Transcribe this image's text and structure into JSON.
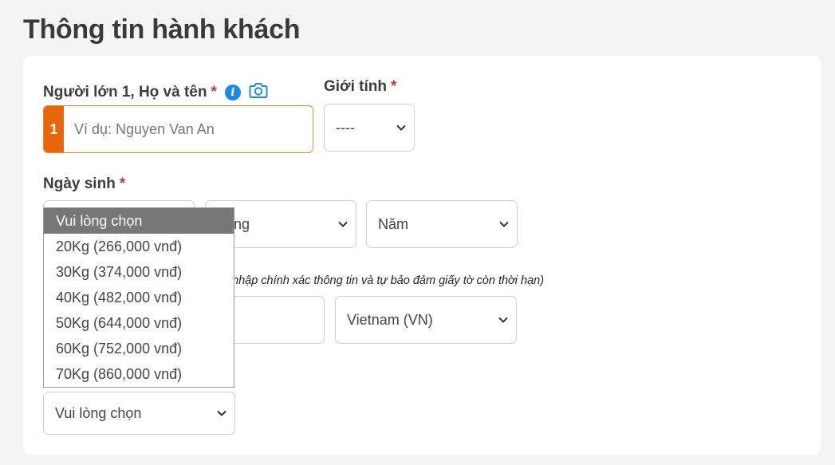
{
  "page": {
    "title": "Thông tin hành khách"
  },
  "passenger": {
    "index": "1",
    "name_label": "Người lớn 1, Họ và tên",
    "name_placeholder": "Ví dụ: Nguyen Van An",
    "required_mark": "*",
    "gender_label": "Giới tính",
    "gender_value": "----",
    "dob_label": "Ngày sinh",
    "dob_month_value": "áng",
    "dob_year_value": "Năm",
    "document_note": "nhập chính xác thông tin và tự bảo đảm giấy tờ còn thời hạn)",
    "nationality_value": "Vietnam (VN)",
    "baggage_value": "Vui lòng chọn"
  },
  "baggage_dropdown": {
    "selected_index": 0,
    "options": [
      "Vui lòng chọn",
      "20Kg (266,000 vnđ)",
      "30Kg (374,000 vnđ)",
      "40Kg (482,000 vnđ)",
      "50Kg (644,000 vnđ)",
      "60Kg (752,000 vnđ)",
      "70Kg (860,000 vnđ)"
    ]
  },
  "colors": {
    "accent": "#e8650e",
    "info": "#1e88e5",
    "required": "#c0392b",
    "selected_bg": "#777777"
  },
  "icons": {
    "info": "info-icon",
    "camera": "camera-icon",
    "chevron": "chevron-down-icon"
  }
}
